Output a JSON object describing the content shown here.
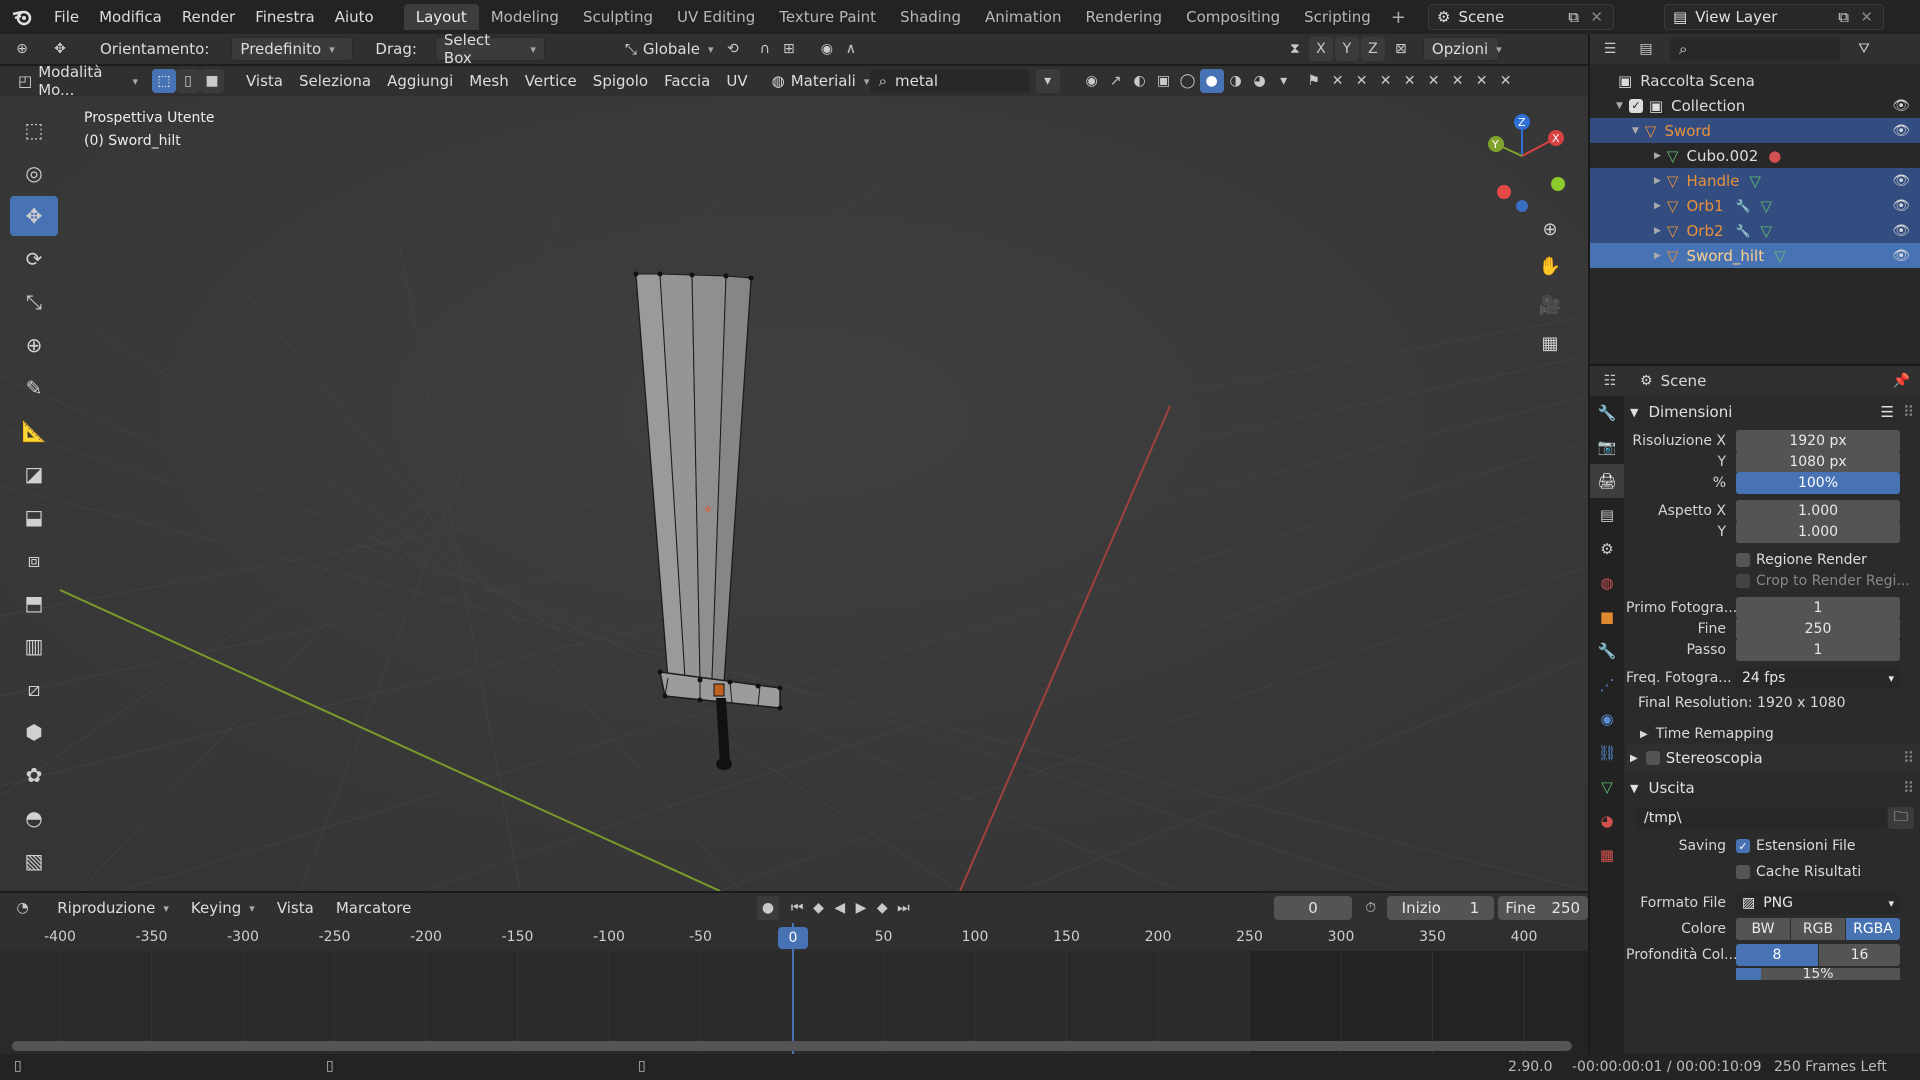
{
  "menubar": {
    "items": [
      "File",
      "Modifica",
      "Render",
      "Finestra",
      "Aiuto"
    ],
    "workspaces": [
      "Layout",
      "Modeling",
      "Sculpting",
      "UV Editing",
      "Texture Paint",
      "Shading",
      "Animation",
      "Rendering",
      "Compositing",
      "Scripting"
    ],
    "active_workspace": "Layout",
    "scene": "Scene",
    "view_layer": "View Layer"
  },
  "tool_header": {
    "orientation_label": "Orientamento:",
    "orientation_value": "Predefinito",
    "drag_label": "Drag:",
    "drag_value": "Select Box",
    "transform_space": "Globale",
    "axes": [
      "X",
      "Y",
      "Z"
    ],
    "options": "Opzioni"
  },
  "viewport_header": {
    "mode": "Modalità Mo...",
    "menus": [
      "Vista",
      "Seleziona",
      "Aggiungi",
      "Mesh",
      "Vertice",
      "Spigolo",
      "Faccia",
      "UV"
    ],
    "material_mode": "Materiali",
    "search_value": "metal"
  },
  "viewport": {
    "view_name": "Prospettiva Utente",
    "object_name": "(0) Sword_hilt",
    "gizmo_axes": [
      "X",
      "Y",
      "Z"
    ]
  },
  "timeline": {
    "menus": [
      "Riproduzione",
      "Keying",
      "Vista",
      "Marcatore"
    ],
    "current_frame": "0",
    "start_label": "Inizio",
    "start_value": "1",
    "end_label": "Fine",
    "end_value": "250",
    "ruler_ticks": [
      "-400",
      "-350",
      "-300",
      "-250",
      "-200",
      "-150",
      "-100",
      "-50",
      "0",
      "50",
      "100",
      "150",
      "200",
      "250",
      "300",
      "350",
      "400"
    ],
    "playhead_label": "0"
  },
  "outliner": {
    "root": "Raccolta Scena",
    "rows": [
      {
        "label": "Collection",
        "color": "#dddddd"
      },
      {
        "label": "Sword",
        "color": "#e8913a"
      },
      {
        "label": "Cubo.002",
        "color": "#dddddd"
      },
      {
        "label": "Handle",
        "color": "#e8913a"
      },
      {
        "label": "Orb1",
        "color": "#e8913a"
      },
      {
        "label": "Orb2",
        "color": "#e8913a"
      },
      {
        "label": "Sword_hilt",
        "color": "#ffd28c"
      }
    ]
  },
  "properties": {
    "context": "Scene",
    "dimensions": {
      "title": "Dimensioni",
      "res_x_label": "Risoluzione X",
      "res_x": "1920 px",
      "res_y_label": "Y",
      "res_y": "1080 px",
      "pct_label": "%",
      "pct": "100%",
      "aspect_x_label": "Aspetto X",
      "aspect_x": "1.000",
      "aspect_y_label": "Y",
      "aspect_y": "1.000",
      "render_region": "Regione Render",
      "crop": "Crop to Render Regi...",
      "frame_start_label": "Primo Fotogra...",
      "frame_start": "1",
      "frame_end_label": "Fine",
      "frame_end": "250",
      "step_label": "Passo",
      "step": "1",
      "fps_label": "Freq. Fotogra...",
      "fps": "24 fps",
      "final_res": "Final Resolution: 1920 x 1080",
      "time_remapping": "Time Remapping"
    },
    "stereo": "Stereoscopia",
    "output": {
      "title": "Uscita",
      "path": "/tmp\\",
      "saving_label": "Saving",
      "file_ext": "Estensioni File",
      "cache": "Cache Risultati",
      "format_label": "Formato File",
      "format": "PNG",
      "color_label": "Colore",
      "color_opts": [
        "BW",
        "RGB",
        "RGBA"
      ],
      "depth_label": "Profondità Col...",
      "depth_opts": [
        "8",
        "16"
      ],
      "compression_pct": "15%"
    }
  },
  "statusbar": {
    "version": "2.90.0",
    "time": "-00:00:00:01 / 00:00:10:09",
    "frames_left": "250 Frames Left"
  }
}
